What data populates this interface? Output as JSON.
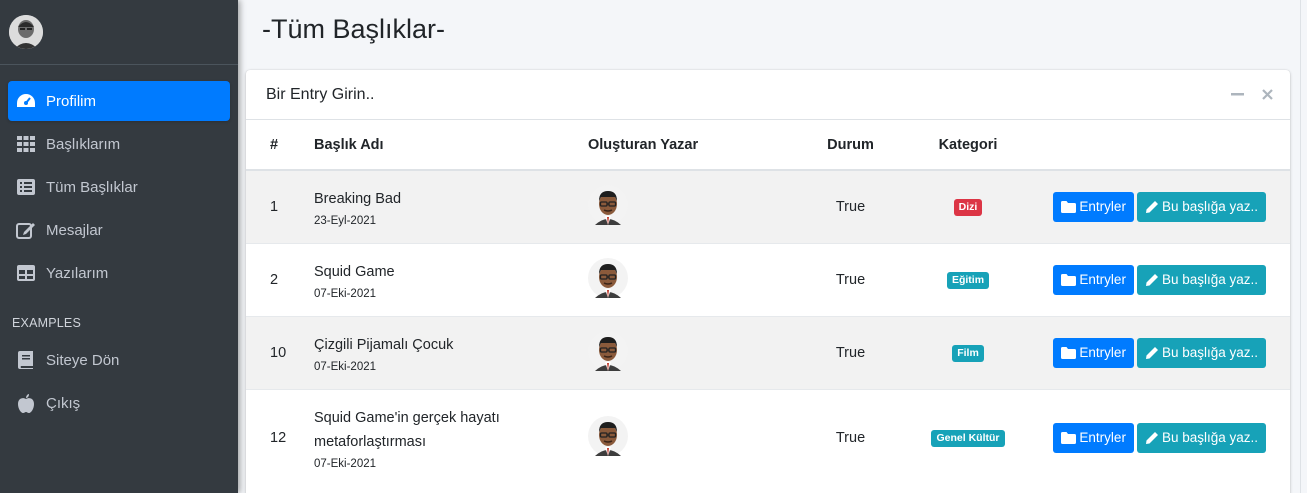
{
  "sidebar": {
    "items": [
      {
        "label": "Profilim",
        "icon": "tachometer-icon",
        "active": true
      },
      {
        "label": "Başlıklarım",
        "icon": "grid-icon"
      },
      {
        "label": "Tüm Başlıklar",
        "icon": "list-icon"
      },
      {
        "label": "Mesajlar",
        "icon": "edit-icon"
      },
      {
        "label": "Yazılarım",
        "icon": "table-icon"
      }
    ],
    "section_header": "EXAMPLES",
    "examples": [
      {
        "label": "Siteye Dön",
        "icon": "book-icon"
      },
      {
        "label": "Çıkış",
        "icon": "apple-icon"
      }
    ]
  },
  "page": {
    "title": "-Tüm Başlıklar-"
  },
  "card": {
    "title": "Bir Entry Girin..",
    "columns": [
      "#",
      "Başlık Adı",
      "Oluşturan Yazar",
      "Durum",
      "Kategori",
      ""
    ],
    "rows": [
      {
        "no": "1",
        "title": "Breaking Bad",
        "date": "23-Eyl-2021",
        "status": "True",
        "category": "Dizi",
        "category_color": "#dc3545"
      },
      {
        "no": "2",
        "title": "Squid Game",
        "date": "07-Eki-2021",
        "status": "True",
        "category": "Eğitim",
        "category_color": "#17a2b8"
      },
      {
        "no": "10",
        "title": "Çizgili Pijamalı Çocuk",
        "date": "07-Eki-2021",
        "status": "True",
        "category": "Film",
        "category_color": "#17a2b8"
      },
      {
        "no": "12",
        "title": "Squid Game'in gerçek hayatı metaforlaştırması",
        "date": "07-Eki-2021",
        "status": "True",
        "category": "Genel Kültür",
        "category_color": "#17a2b8"
      }
    ],
    "btn_entries": "Entryler",
    "btn_write": "Bu başlığa yaz.."
  },
  "colors": {
    "primary": "#007bff",
    "info": "#17a2b8",
    "danger": "#dc3545",
    "sidebar": "#343a40"
  }
}
